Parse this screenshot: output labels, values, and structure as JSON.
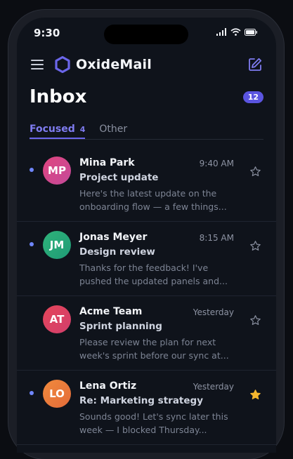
{
  "status": {
    "time": "9:30"
  },
  "header": {
    "app_name": "OxideMail"
  },
  "inbox": {
    "title": "Inbox",
    "badge": "12"
  },
  "tabs": [
    {
      "label": "Focused",
      "count": "4",
      "active": true
    },
    {
      "label": "Other",
      "count": "",
      "active": false
    }
  ],
  "emails": [
    {
      "initials": "MP",
      "sender": "Mina Park",
      "time": "9:40 AM",
      "subject": "Project update",
      "preview": "Here's the latest update on the onboarding flow — a few things...",
      "unread": true,
      "starred": false,
      "avatar_colors": [
        "#e0457f",
        "#c44a9a"
      ]
    },
    {
      "initials": "JM",
      "sender": "Jonas Meyer",
      "time": "8:15 AM",
      "subject": "Design review",
      "preview": "Thanks for the feedback! I've pushed the updated panels and...",
      "unread": true,
      "starred": false,
      "avatar_colors": [
        "#2fb37a",
        "#1f9b76"
      ]
    },
    {
      "initials": "AT",
      "sender": "Acme Team",
      "time": "Yesterday",
      "subject": "Sprint planning",
      "preview": "Please review the plan for next week's sprint before our sync at...",
      "unread": false,
      "starred": false,
      "avatar_colors": [
        "#e5455a",
        "#d23f6c"
      ]
    },
    {
      "initials": "LO",
      "sender": "Lena Ortiz",
      "time": "Yesterday",
      "subject": "Re: Marketing strategy",
      "preview": "Sounds good! Let's sync later this week — I blocked Thursday...",
      "unread": true,
      "starred": true,
      "avatar_colors": [
        "#f08a3c",
        "#e46b3a"
      ]
    }
  ],
  "colors": {
    "accent": "#6b66ea",
    "star_active": "#f5b62e",
    "unread_dot": "#6f86ff"
  }
}
